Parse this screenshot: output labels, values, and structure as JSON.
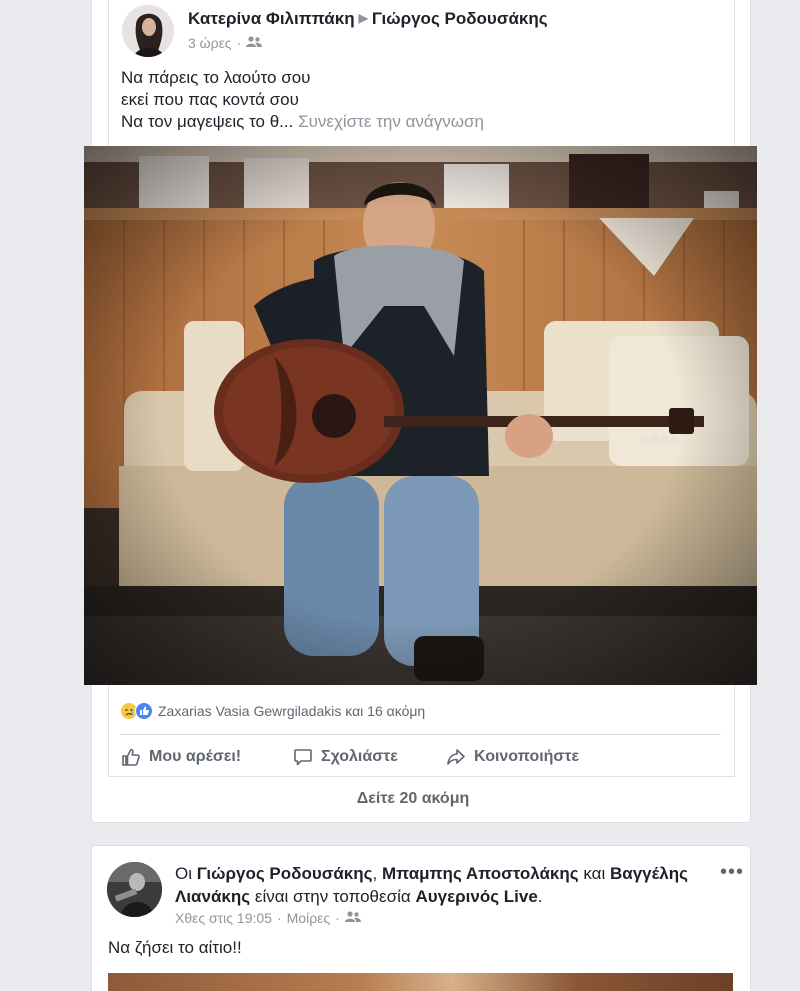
{
  "post1": {
    "author": "Κατερίνα Φιλιππάκη",
    "target": "Γιώργος Ροδουσάκης",
    "time": "3 ώρες",
    "meta_sep": "·",
    "text_line1": "Να πάρεις το λαούτο σου",
    "text_line2": "εκεί που πας κοντά σου",
    "text_line3": "Να τον μαγεψεις το θ...",
    "continue_reading": "Συνεχίστε την ανάγνωση",
    "reactions_names": "Zaxarias Vasia Gewrgiladakis και 16 ακόμη",
    "like_label": "Μου αρέσει!",
    "comment_label": "Σχολιάστε",
    "share_label": "Κοινοποιήστε",
    "see_more": "Δείτε 20 ακόμη"
  },
  "post2": {
    "prefix": "Οι",
    "name1": "Γιώργος Ροδουσάκης",
    "comma": ",",
    "name2": "Μπαμπης Αποστολάκης",
    "and": "και",
    "name3": "Βαγγέλης Λιανάκης",
    "at_text": "είναι στην τοποθεσία",
    "place": "Αυγερινός Live",
    "period": ".",
    "time": "Χθες στις 19:05",
    "sep": "·",
    "location": "Μοίρες",
    "sep2": "·",
    "text": "Να ζήσει το αίτιο!!",
    "menu": "•••"
  },
  "colors": {
    "link": "#1d2129",
    "muted": "#90949c",
    "like_blue": "#4a84f5",
    "sad_yellow": "#f7c940",
    "background": "#e9ebee"
  }
}
